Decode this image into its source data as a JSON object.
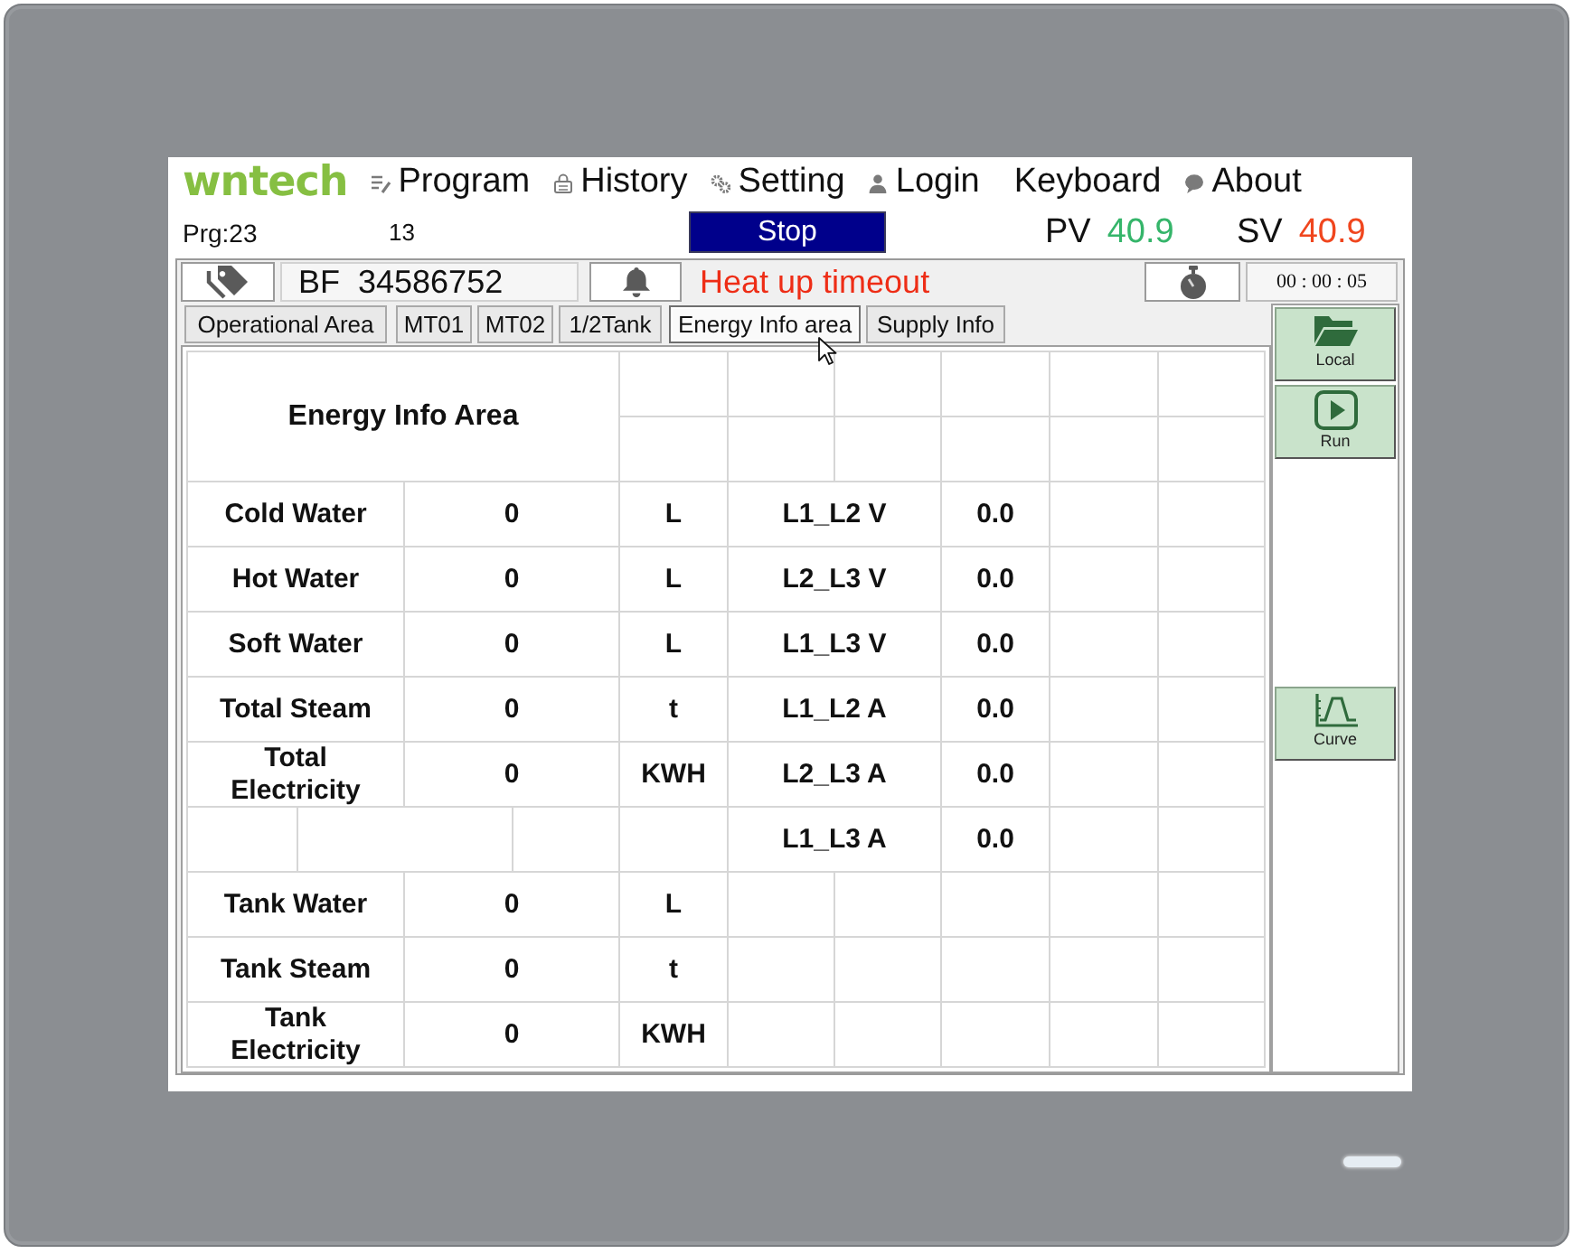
{
  "menu": {
    "logo": "wntech",
    "items": [
      {
        "kind": "notes",
        "label": "Program"
      },
      {
        "kind": "lock",
        "label": "History"
      },
      {
        "kind": "gears",
        "label": "Setting"
      },
      {
        "kind": "user",
        "label": "Login"
      },
      {
        "kind": "plain",
        "label": "Keyboard"
      },
      {
        "kind": "chat",
        "label": "About"
      }
    ]
  },
  "status": {
    "program": "Prg:23",
    "step": "13",
    "run_state": "Stop",
    "pv": {
      "label": "PV",
      "value": "40.9"
    },
    "sv": {
      "label": "SV",
      "value": "40.9"
    }
  },
  "info_bar": {
    "batch": "BF  34586752",
    "alarm": "Heat up timeout",
    "elapsed": "00 : 00 : 05"
  },
  "tabs": [
    {
      "label": "Operational Area",
      "selected": false
    },
    {
      "label": "MT01",
      "selected": false
    },
    {
      "label": "MT02",
      "selected": false
    },
    {
      "label": "1/2Tank",
      "selected": false
    },
    {
      "label": "Energy Info area",
      "selected": true
    },
    {
      "label": "Supply Info",
      "selected": false
    }
  ],
  "table": {
    "title": "Energy Info Area",
    "meters": [
      {
        "name": "Cold Water",
        "value": "0",
        "unit": "L"
      },
      {
        "name": "Hot Water",
        "value": "0",
        "unit": "L"
      },
      {
        "name": "Soft Water",
        "value": "0",
        "unit": "L"
      },
      {
        "name": "Total Steam",
        "value": "0",
        "unit": "t"
      },
      {
        "name": "Total Electricity",
        "value": "0",
        "unit": "KWH"
      }
    ],
    "tank_meters": [
      {
        "name": "Tank Water",
        "value": "0",
        "unit": "L"
      },
      {
        "name": "Tank Steam",
        "value": "0",
        "unit": "t"
      },
      {
        "name": "Tank Electricity",
        "value": "0",
        "unit": "KWH"
      }
    ],
    "electrical": [
      {
        "name": "L1_L2 V",
        "value": "0.0"
      },
      {
        "name": "L2_L3 V",
        "value": "0.0"
      },
      {
        "name": "L1_L3 V",
        "value": "0.0"
      },
      {
        "name": "L1_L2 A",
        "value": "0.0"
      },
      {
        "name": "L2_L3 A",
        "value": "0.0"
      },
      {
        "name": "L1_L3 A",
        "value": "0.0"
      }
    ]
  },
  "side_buttons": [
    {
      "kind": "folder",
      "label": "Local"
    },
    {
      "kind": "play",
      "label": "Run"
    },
    {
      "kind": "curve",
      "label": "Curve"
    }
  ]
}
